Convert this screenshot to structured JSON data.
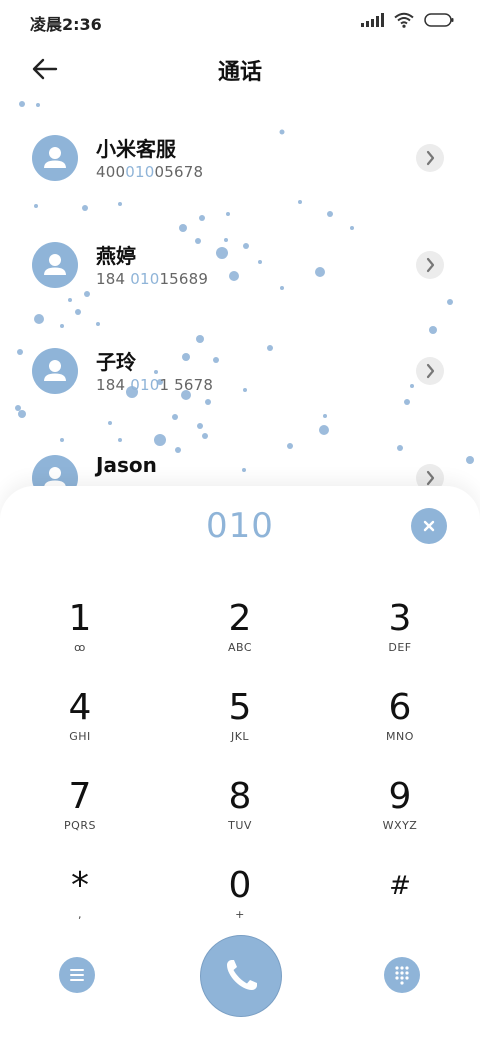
{
  "status_bar": {
    "time": "凌晨2:36"
  },
  "header": {
    "title": "通话"
  },
  "contacts": [
    {
      "name": "小米客服",
      "number_parts": [
        "400",
        "010",
        "05678"
      ]
    },
    {
      "name": "燕婷",
      "number_parts": [
        "184 ",
        "010",
        "15689"
      ]
    },
    {
      "name": "子玲",
      "number_parts": [
        "184 ",
        "010",
        "1 5678"
      ]
    },
    {
      "name": "Jason",
      "number_parts": [
        "",
        "",
        ""
      ]
    }
  ],
  "dialer": {
    "entered": "010",
    "keys": [
      {
        "num": "1",
        "sub": "ꝏ"
      },
      {
        "num": "2",
        "sub": "ABC"
      },
      {
        "num": "3",
        "sub": "DEF"
      },
      {
        "num": "4",
        "sub": "GHI"
      },
      {
        "num": "5",
        "sub": "JKL"
      },
      {
        "num": "6",
        "sub": "MNO"
      },
      {
        "num": "7",
        "sub": "PQRS"
      },
      {
        "num": "8",
        "sub": "TUV"
      },
      {
        "num": "9",
        "sub": "WXYZ"
      },
      {
        "num": "*",
        "sub": ","
      },
      {
        "num": "0",
        "sub": "+"
      },
      {
        "num": "#",
        "sub": ""
      }
    ]
  },
  "colors": {
    "accent": "#8fb4d8",
    "chevron_bg": "#ececec"
  },
  "icons": {
    "back": "arrow-left-icon",
    "contact": "person-icon",
    "chevron": "chevron-right-icon",
    "clear": "close-icon",
    "menu": "menu-icon",
    "call": "phone-icon",
    "keypad": "keypad-icon"
  }
}
